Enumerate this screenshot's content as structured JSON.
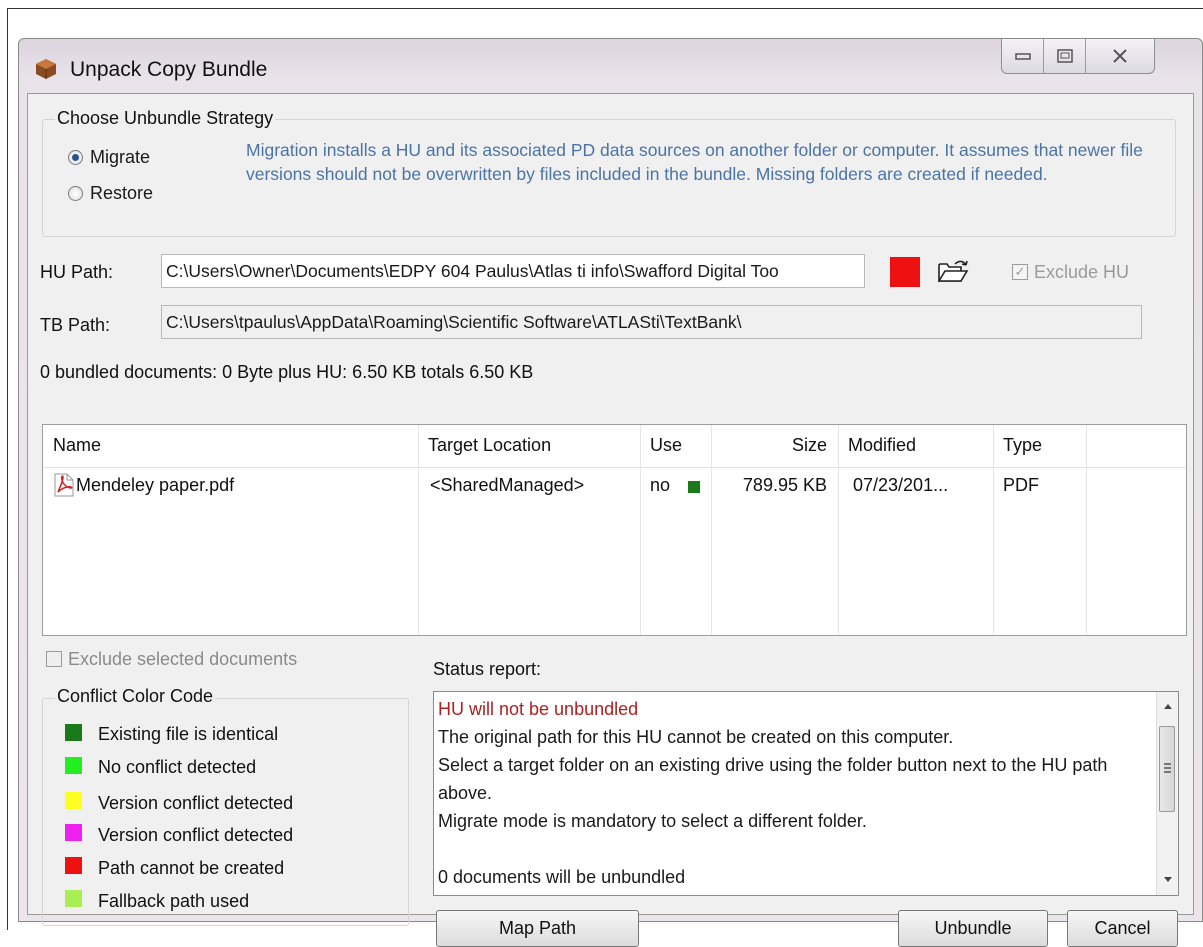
{
  "window": {
    "title": "Unpack Copy Bundle"
  },
  "strategy": {
    "title": "Choose Unbundle Strategy",
    "options": [
      {
        "label": "Migrate",
        "selected": true
      },
      {
        "label": "Restore",
        "selected": false
      }
    ],
    "description": "Migration installs a HU and its associated PD data sources on another folder or computer. It assumes that newer file versions should not be overwritten by files included in the bundle. Missing folders are created if needed."
  },
  "paths": {
    "hu_label": "HU Path:",
    "hu_value": "C:\\Users\\Owner\\Documents\\EDPY 604 Paulus\\Atlas ti info\\Swafford Digital Too",
    "tb_label": "TB Path:",
    "tb_value": "C:\\Users\\tpaulus\\AppData\\Roaming\\Scientific Software\\ATLASti\\TextBank\\",
    "exclude_hu_label": "Exclude HU",
    "exclude_hu_checked": true,
    "status_color": "#ee1111"
  },
  "summary": "0 bundled documents: 0 Byte plus HU: 6.50 KB totals 6.50 KB",
  "table": {
    "columns": [
      "Name",
      "Target Location",
      "Use",
      "Size",
      "Modified",
      "Type"
    ],
    "rows": [
      {
        "name": "Mendeley paper.pdf",
        "target": "<SharedManaged>",
        "use": "no",
        "use_color": "#1a7a1a",
        "size": "789.95 KB",
        "modified": "07/23/201...",
        "type": "PDF"
      }
    ]
  },
  "exclude_selected": {
    "label": "Exclude selected documents"
  },
  "legend": {
    "title": "Conflict Color Code",
    "items": [
      {
        "label": "Existing file is identical",
        "color": "#1a7a1a"
      },
      {
        "label": "No conflict detected",
        "color": "#22ee22"
      },
      {
        "label": "Version conflict detected",
        "color": "#ffff22"
      },
      {
        "label": "Version conflict detected",
        "color": "#ee22ee"
      },
      {
        "label": "Path cannot be created",
        "color": "#ee1111"
      },
      {
        "label": "Fallback path used",
        "color": "#aaee55"
      }
    ]
  },
  "status_report": {
    "label": "Status report:",
    "headline": "HU will not be unbundled",
    "headline_color": "#b02020",
    "lines": [
      "The original path for this HU cannot be created on this computer.",
      "Select a target folder on an existing drive using the  folder button next to the HU path above.",
      "Migrate mode is mandatory to select a different folder.",
      "",
      "0 documents will be unbundled"
    ]
  },
  "buttons": {
    "map_path": "Map Path",
    "unbundle": "Unbundle",
    "cancel": "Cancel"
  }
}
